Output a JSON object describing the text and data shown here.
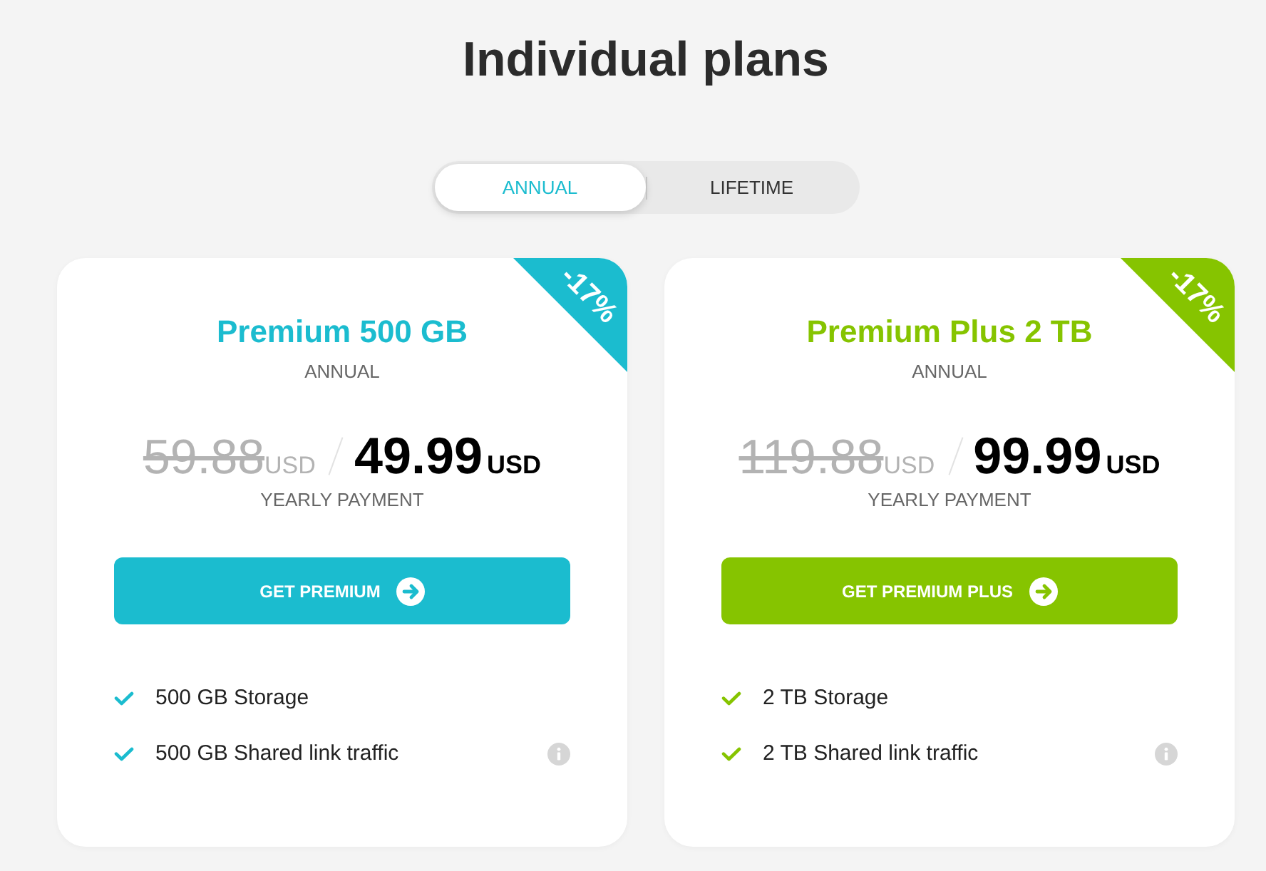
{
  "page": {
    "title": "Individual plans"
  },
  "billing_toggle": [
    {
      "label": "ANNUAL",
      "selected": true
    },
    {
      "label": "LIFETIME",
      "selected": false
    }
  ],
  "plans": [
    {
      "name": "Premium 500 GB",
      "color": "#1bbccf",
      "discount": "-17%",
      "period": "ANNUAL",
      "old_price": "59.88",
      "old_currency": "USD",
      "price": "49.99",
      "currency": "USD",
      "price_note": "YEARLY PAYMENT",
      "button": "GET PREMIUM",
      "features": [
        {
          "label": "500 GB Storage",
          "info": false
        },
        {
          "label": "500 GB Shared link traffic",
          "info": true
        }
      ]
    },
    {
      "name": "Premium Plus 2 TB",
      "color": "#86c400",
      "discount": "-17%",
      "period": "ANNUAL",
      "old_price": "119.88",
      "old_currency": "USD",
      "price": "99.99",
      "currency": "USD",
      "price_note": "YEARLY PAYMENT",
      "button": "GET PREMIUM PLUS",
      "features": [
        {
          "label": "2 TB Storage",
          "info": false
        },
        {
          "label": "2 TB Shared link traffic",
          "info": true
        }
      ]
    }
  ]
}
